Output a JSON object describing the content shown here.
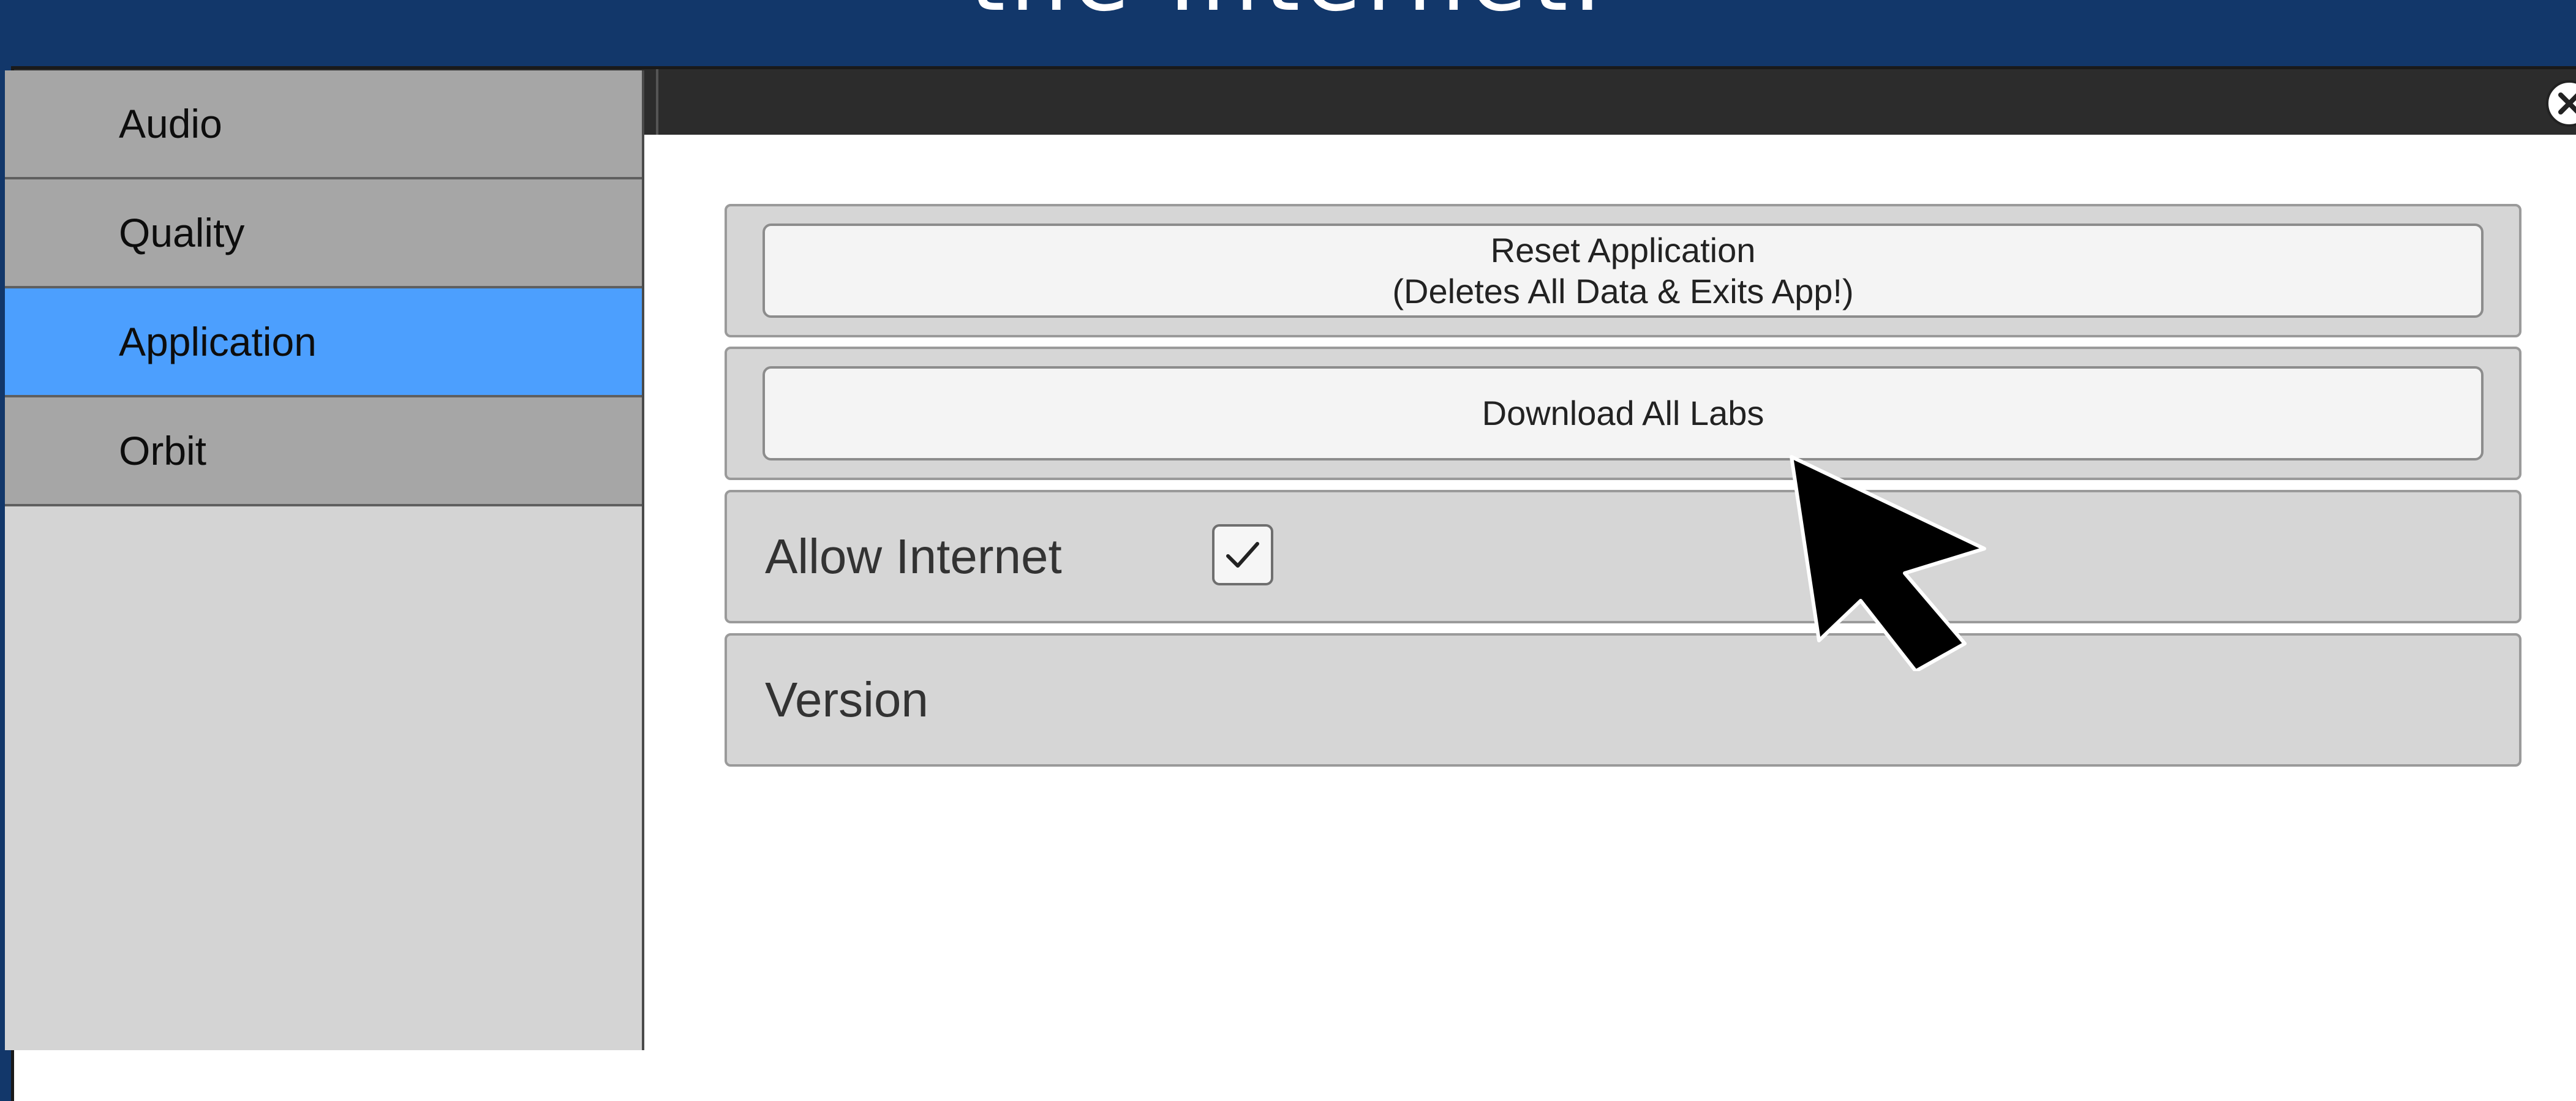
{
  "caption": {
    "text": "the Internet."
  },
  "sidebar": {
    "items": [
      {
        "label": "Audio",
        "active": false
      },
      {
        "label": "Quality",
        "active": false
      },
      {
        "label": "Application",
        "active": true
      },
      {
        "label": "Orbit",
        "active": false
      }
    ]
  },
  "main": {
    "reset": {
      "line1": "Reset Application",
      "line2": "(Deletes All Data & Exits App!)"
    },
    "download": {
      "label": "Download All Labs"
    },
    "allow_internet": {
      "label": "Allow Internet",
      "checked": true
    },
    "version": {
      "label": "Version"
    }
  },
  "icons": {
    "close": "close-icon",
    "check": "checkmark-icon",
    "cursor": "mouse-pointer-icon"
  },
  "colors": {
    "background": "#12376a",
    "titlebar": "#2c2c2c",
    "sidebar_item": "#a6a6a6",
    "sidebar_active": "#4c9ffe",
    "panel": "#d6d6d6"
  }
}
